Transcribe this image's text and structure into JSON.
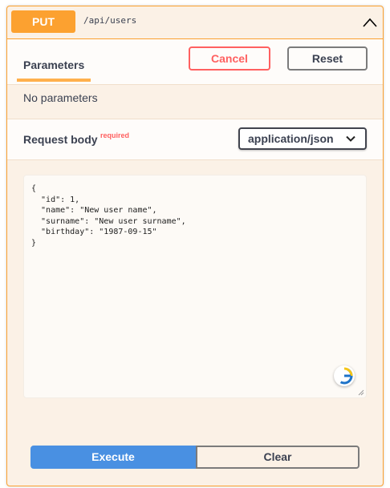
{
  "summary": {
    "method": "PUT",
    "path": "/api/users",
    "collapse_icon": "chevron-up-icon"
  },
  "parameters": {
    "tab_label": "Parameters",
    "cancel_label": "Cancel",
    "reset_label": "Reset",
    "empty_text": "No parameters"
  },
  "request_body": {
    "title": "Request body",
    "required_label": "required",
    "content_type": "application/json",
    "body": "{\n  \"id\": 1,\n  \"name\": \"New user name\",\n  \"surname\": \"New user surname\",\n  \"birthday\": \"1987-09-15\"\n}",
    "extension_icon": "grammarly-g-icon"
  },
  "actions": {
    "execute_label": "Execute",
    "clear_label": "Clear"
  },
  "colors": {
    "put_accent": "#fca130",
    "danger": "#ff6060",
    "execute_blue": "#4990e2"
  }
}
